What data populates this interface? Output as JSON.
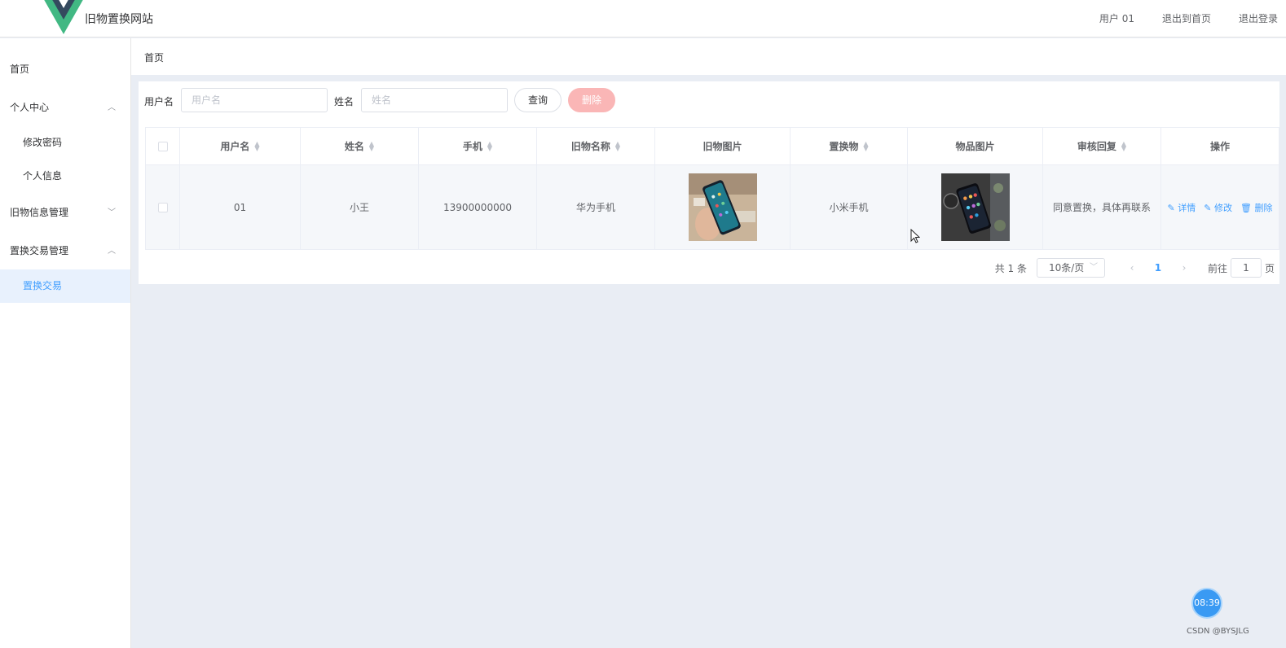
{
  "header": {
    "site_title": "旧物置换网站",
    "user": "用户 01",
    "back_home": "退出到首页",
    "logout": "退出登录"
  },
  "sidebar": {
    "items": [
      {
        "label": "首页"
      },
      {
        "label": "个人中心",
        "expanded": true
      },
      {
        "label": "修改密码"
      },
      {
        "label": "个人信息"
      },
      {
        "label": "旧物信息管理",
        "expanded": false
      },
      {
        "label": "置换交易管理",
        "expanded": true
      },
      {
        "label": "置换交易",
        "active": true
      }
    ]
  },
  "breadcrumb": "首页",
  "search": {
    "username_label": "用户名",
    "username_placeholder": "用户名",
    "name_label": "姓名",
    "name_placeholder": "姓名",
    "query_label": "查询",
    "delete_label": "删除"
  },
  "table": {
    "columns": [
      "用户名",
      "姓名",
      "手机",
      "旧物名称",
      "旧物图片",
      "置换物",
      "物品图片",
      "审核回复",
      "操作"
    ],
    "rows": [
      {
        "username": "01",
        "name": "小王",
        "phone": "13900000000",
        "old_item": "华为手机",
        "exchange_item": "小米手机",
        "review_reply": "同意置换，具体再联系",
        "actions": [
          "详情",
          "修改",
          "删除"
        ]
      }
    ]
  },
  "pagination": {
    "total": "共 1 条",
    "page_size": "10条/页",
    "current_page": "1",
    "goto_prefix": "前往",
    "goto_value": "1",
    "goto_suffix": "页"
  },
  "clock": "08:39",
  "watermark": "CSDN @BYSJLG",
  "colors": {
    "accent": "#409eff",
    "danger_light": "#fab6b6",
    "logo_green": "#41b883",
    "logo_dark": "#34495e"
  }
}
